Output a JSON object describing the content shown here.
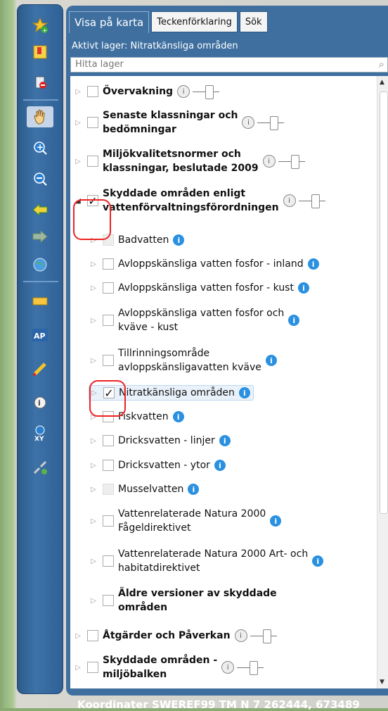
{
  "tabs": [
    "Visa på karta",
    "Teckenförklaring",
    "Sök"
  ],
  "active_layer": "Aktivt lager:  Nitratkänsliga områden",
  "search": {
    "placeholder": "Hitta lager"
  },
  "toolbar_icons": [
    "star-add-icon",
    "bookmark-icon",
    "delete-icon",
    "pan-hand-icon",
    "zoom-in-icon",
    "zoom-out-icon",
    "back-arrow-icon",
    "forward-arrow-icon",
    "full-extent-icon",
    "measure-icon",
    "ap-icon",
    "draw-icon",
    "identify-icon",
    "xy-coordinate-icon",
    "link-icon"
  ],
  "tree": {
    "overvakning": "Övervakning",
    "senaste_1": "Senaste klassningar och",
    "senaste_2": "bedömningar",
    "miljo_1": "Miljökvalitetsnormer och",
    "miljo_2": "klassningar, beslutade 2009",
    "skydd_1": "Skyddade områden enligt",
    "skydd_2": "vattenförvaltningsförordningen",
    "badvatten": "Badvatten",
    "avlopp_inland": "Avloppskänsliga vatten fosfor - inland",
    "avlopp_kust": "Avloppskänsliga vatten fosfor - kust",
    "avlopp_kvave_1": "Avloppskänsliga vatten fosfor och",
    "avlopp_kvave_2": "kväve - kust",
    "tillrinning_1": "Tillrinningsområde",
    "tillrinning_2": "avloppskänsligavatten kväve",
    "nitrat": "Nitratkänsliga områden",
    "fisk": "Fiskvatten",
    "dricks_linjer": "Dricksvatten - linjer",
    "dricks_ytor": "Dricksvatten - ytor",
    "mussel": "Musselvatten",
    "natura_fagel_1": "Vattenrelaterade Natura 2000",
    "natura_fagel_2": "Fågeldirektivet",
    "natura_art_1": "Vattenrelaterade Natura 2000 Art- och",
    "natura_art_2": "habitatdirektivet",
    "aldre_1": "Äldre versioner av skyddade",
    "aldre_2": "områden",
    "atgarder": "Åtgärder och Påverkan",
    "miljo_balk_1": "Skyddade områden -",
    "miljo_balk_2": "miljöbalken"
  },
  "coordinates": "Koordinater SWEREF99 TM N 7 262444, 673489"
}
